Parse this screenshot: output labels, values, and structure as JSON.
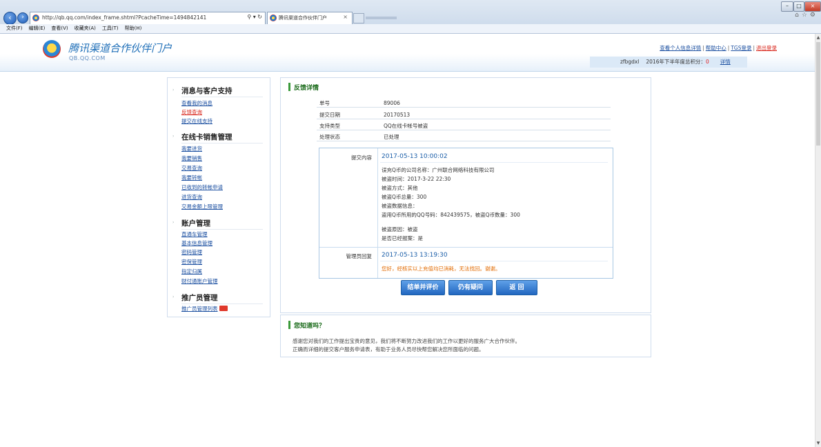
{
  "browser": {
    "url": "http://qb.qq.com/index_frame.shtml?PcacheTime=1494842141",
    "address_tools": "⚲ ▾ ↻",
    "tab_title": "腾讯渠道合作伙伴门户",
    "tab_close": "×",
    "menu": [
      "文件(F)",
      "编辑(E)",
      "查看(V)",
      "收藏夹(A)",
      "工具(T)",
      "帮助(H)"
    ],
    "top_icons": "⌂☆⚙",
    "win_min": "–",
    "win_max": "□",
    "win_close": "×"
  },
  "header": {
    "logo_title": "腾讯渠道合作伙伴门户",
    "logo_sub": "QB.QQ.COM",
    "links": {
      "profile": "查看个人信息详情",
      "help": "帮助中心",
      "tgs": "TGS登录",
      "logout": "退出登录",
      "sep": "|"
    },
    "user": "zfbgdxl",
    "score_label": "2016年下半年度总积分：",
    "score": "0",
    "detail_link": "详情"
  },
  "sidebar": {
    "sections": [
      {
        "title": "消息与客户支持",
        "items": [
          "查看我的消息",
          "反馈查询",
          "提交在线支持"
        ]
      },
      {
        "title": "在线卡销售管理",
        "items": [
          "我要进货",
          "我要销售",
          "交易查询",
          "我要转帐",
          "已收到的转帐申请",
          "进货查询",
          "交易金额上限管理"
        ]
      },
      {
        "title": "账户管理",
        "items": [
          "直通车管理",
          "基本信息管理",
          "密码管理",
          "密保管理",
          "指定归属",
          "财付通账户管理"
        ]
      },
      {
        "title": "推广员管理",
        "items": [
          "推广员管理列表"
        ]
      }
    ],
    "bullet": "›"
  },
  "feedback": {
    "title": "反馈详情",
    "rows": [
      {
        "k": "单号",
        "v": "89006"
      },
      {
        "k": "提交日期",
        "v": "20170513"
      },
      {
        "k": "支持类型",
        "v": "QQ在线卡帐号被盗"
      },
      {
        "k": "处理状态",
        "v": "已处理"
      }
    ],
    "submit_label": "提交内容",
    "submit_time": "2017-05-13 10:00:02",
    "submit_lines": [
      "误充Q币的公司名称：广州联合网络科技有限公司",
      "被盗时间：2017-3-22 22:30",
      "被盗方式：其他",
      "被盗Q币总量：300",
      "被盗数据信息：",
      "盗用Q币所用的QQ号码：842439575，被盗Q币数量：300",
      "被盗原因：被盗",
      "是否已经报案：是"
    ],
    "reply_label": "管理员回复",
    "reply_time": "2017-05-13 13:19:30",
    "reply_text": "您好，经核实以上充值均已消耗，无法找回。谢谢。",
    "buttons": {
      "close_rate": "结单并评价",
      "still_question": "仍有疑问",
      "back": "返 回"
    }
  },
  "tips": {
    "title": "您知道吗？",
    "line1": "感谢您对我们的工作提出宝贵的意见，我们将不断努力改进我们的工作以更好的服务广大合作伙伴。",
    "line2": "正确而详细的提交客户服务申请表，有助于业务人员尽快帮您解决您所面临的问题。"
  }
}
